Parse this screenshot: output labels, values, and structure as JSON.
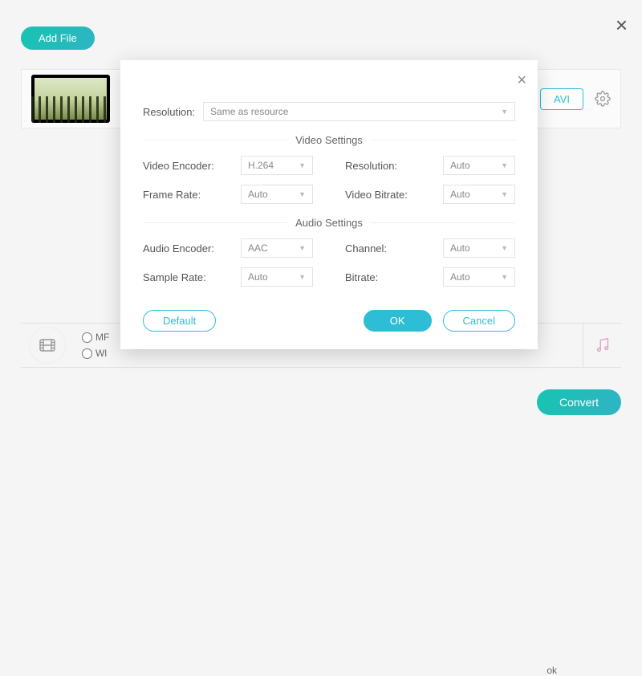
{
  "header": {
    "add_file_label": "Add File"
  },
  "file_item": {
    "format_button": "AVI"
  },
  "format_bar": {
    "radio1_label_fragment": "MF",
    "radio2_label_fragment": "Wl",
    "far_right_fragment": "ok"
  },
  "footer": {
    "convert_label": "Convert"
  },
  "modal": {
    "top_resolution_label": "Resolution:",
    "top_resolution_value": "Same as resource",
    "video_section_title": "Video Settings",
    "audio_section_title": "Audio Settings",
    "video_encoder_label": "Video Encoder:",
    "video_encoder_value": "H.264",
    "frame_rate_label": "Frame Rate:",
    "frame_rate_value": "Auto",
    "v_resolution_label": "Resolution:",
    "v_resolution_value": "Auto",
    "video_bitrate_label": "Video Bitrate:",
    "video_bitrate_value": "Auto",
    "audio_encoder_label": "Audio Encoder:",
    "audio_encoder_value": "AAC",
    "sample_rate_label": "Sample Rate:",
    "sample_rate_value": "Auto",
    "channel_label": "Channel:",
    "channel_value": "Auto",
    "a_bitrate_label": "Bitrate:",
    "a_bitrate_value": "Auto",
    "default_label": "Default",
    "ok_label": "OK",
    "cancel_label": "Cancel"
  }
}
